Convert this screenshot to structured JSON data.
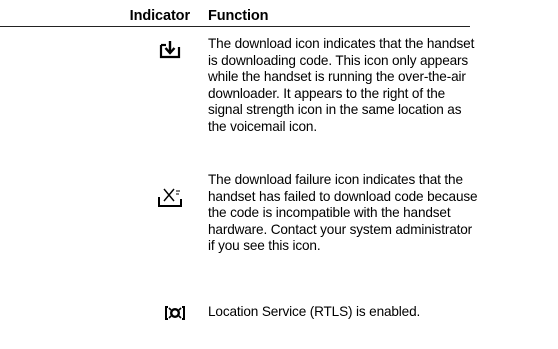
{
  "table": {
    "headers": {
      "indicator": "Indicator",
      "function": "Function"
    },
    "rows": [
      {
        "icon": "download-icon",
        "description": "The download icon indicates that the handset\nis downloading code. This icon only appears\nwhile the handset is running the over-the-air\ndownloader. It appears to the right of the\nsignal strength icon in the same location as\nthe voicemail icon."
      },
      {
        "icon": "download-failure-icon",
        "description": "The download failure icon indicates that the\nhandset has failed to download code because\nthe code is incompatible with the handset\nhardware. Contact your system administrator\nif you see this icon."
      },
      {
        "icon": "location-service-icon",
        "description": "Location Service (RTLS) is enabled."
      }
    ]
  }
}
